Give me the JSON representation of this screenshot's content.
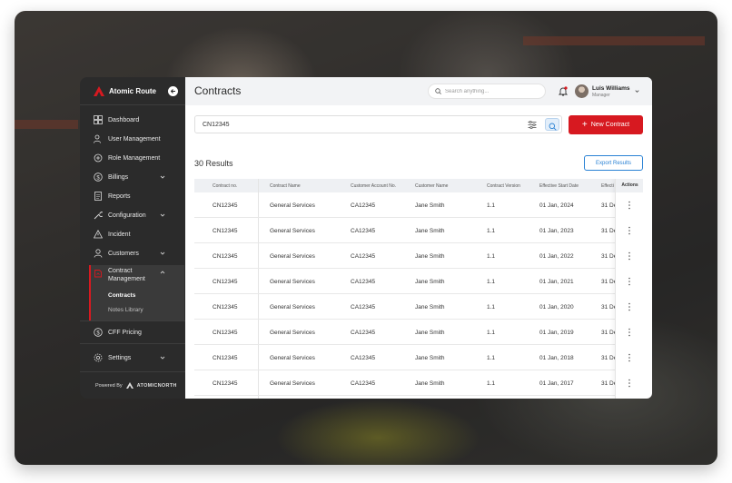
{
  "brand": {
    "name": "Atomic Route",
    "accent": "#d71920"
  },
  "sidebar": {
    "items": [
      {
        "label": "Dashboard",
        "icon": "dashboard-icon"
      },
      {
        "label": "User Management",
        "icon": "users-icon"
      },
      {
        "label": "Role Management",
        "icon": "roles-icon"
      },
      {
        "label": "Billings",
        "icon": "dollar-icon",
        "expandable": true
      },
      {
        "label": "Reports",
        "icon": "report-icon"
      },
      {
        "label": "Configuration",
        "icon": "wrench-icon",
        "expandable": true
      },
      {
        "label": "Incident",
        "icon": "warning-icon"
      },
      {
        "label": "Customers",
        "icon": "customer-icon",
        "expandable": true
      },
      {
        "label": "Contract Management",
        "icon": "contract-icon",
        "expanded": true
      },
      {
        "label": "CFF Pricing",
        "icon": "pricing-icon"
      },
      {
        "label": "Settings",
        "icon": "gear-icon",
        "expandable": true
      }
    ],
    "contract_sub": [
      "Contracts",
      "Notes Library"
    ],
    "contract_label_line1": "Contract",
    "contract_label_line2": "Management",
    "powered_by": "Powered By",
    "powered_logo": "ATOMICNORTH"
  },
  "header": {
    "title": "Contracts",
    "search_placeholder": "Search anything...",
    "user_name": "Luis Williams",
    "user_role": "Manager"
  },
  "filter": {
    "value": "CN12345"
  },
  "actions": {
    "new_contract": "New Contract",
    "export": "Export Results"
  },
  "results_label": "30 Results",
  "table": {
    "columns": [
      "Contract no.",
      "Contract Name",
      "Customer Account No.",
      "Customer Name",
      "Contract Version",
      "Effective Start Date",
      "Effecti",
      "Actions"
    ],
    "rows": [
      [
        "CN12345",
        "General Services",
        "CA12345",
        "Jane Smith",
        "1.1",
        "01 Jan, 2024",
        "31 De"
      ],
      [
        "CN12345",
        "General Services",
        "CA12345",
        "Jane Smith",
        "1.1",
        "01 Jan, 2023",
        "31 De"
      ],
      [
        "CN12345",
        "General Services",
        "CA12345",
        "Jane Smith",
        "1.1",
        "01 Jan, 2022",
        "31 De"
      ],
      [
        "CN12345",
        "General Services",
        "CA12345",
        "Jane Smith",
        "1.1",
        "01 Jan, 2021",
        "31 De"
      ],
      [
        "CN12345",
        "General Services",
        "CA12345",
        "Jane Smith",
        "1.1",
        "01 Jan, 2020",
        "31 De"
      ],
      [
        "CN12345",
        "General Services",
        "CA12345",
        "Jane Smith",
        "1.1",
        "01 Jan, 2019",
        "31 De"
      ],
      [
        "CN12345",
        "General Services",
        "CA12345",
        "Jane Smith",
        "1.1",
        "01 Jan, 2018",
        "31 De"
      ],
      [
        "CN12345",
        "General Services",
        "CA12345",
        "Jane Smith",
        "1.1",
        "01 Jan, 2017",
        "31 De"
      ]
    ]
  }
}
